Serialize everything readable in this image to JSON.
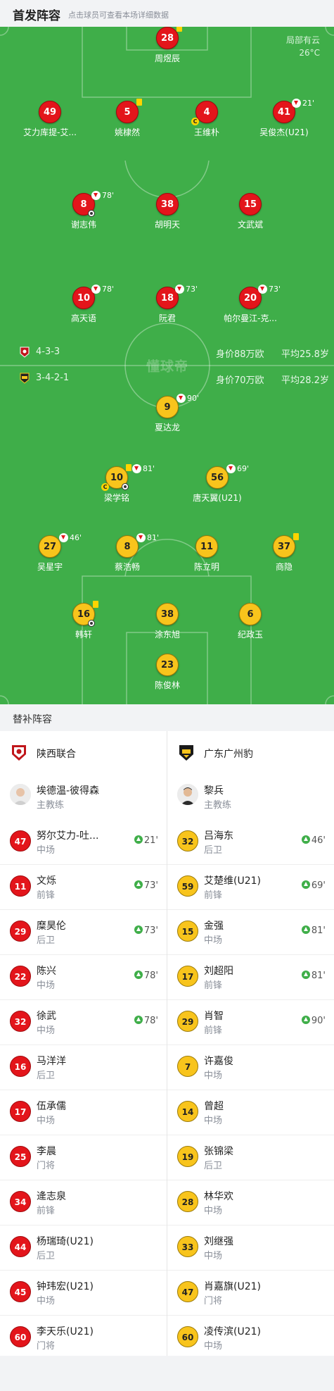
{
  "header": {
    "title": "首发阵容",
    "subtitle": "点击球员可查看本场详细数据"
  },
  "weather": {
    "condition": "局部有云",
    "temperature": "26°C"
  },
  "watermark": "懂球帝",
  "teams": {
    "home": {
      "name": "陕西联合",
      "formation": "4-3-3",
      "value": "身价88万欧",
      "avg_age": "平均25.8岁",
      "color": "#e3151b"
    },
    "away": {
      "name": "广东广州豹",
      "formation": "3-4-2-1",
      "value": "身价70万欧",
      "avg_age": "平均28.2岁",
      "color": "#f8c41c"
    }
  },
  "home_starters": [
    {
      "num": "28",
      "name": "周煜辰",
      "yellow": true
    },
    {
      "num": "49",
      "name": "艾力库提-艾..."
    },
    {
      "num": "5",
      "name": "姚棣然",
      "yellow": true
    },
    {
      "num": "4",
      "name": "王维朴",
      "captain": true
    },
    {
      "num": "41",
      "name": "吴俊杰(U21)",
      "sub_off": "21'"
    },
    {
      "num": "8",
      "name": "谢志伟",
      "sub_off": "78'",
      "goal": true
    },
    {
      "num": "38",
      "name": "胡明天"
    },
    {
      "num": "15",
      "name": "文武斌"
    },
    {
      "num": "10",
      "name": "高天语",
      "sub_off": "78'"
    },
    {
      "num": "18",
      "name": "阮君",
      "sub_off": "73'"
    },
    {
      "num": "20",
      "name": "帕尔曼江-克...",
      "sub_off": "73'"
    }
  ],
  "away_starters": [
    {
      "num": "9",
      "name": "夏达龙",
      "sub_off": "90'"
    },
    {
      "num": "10",
      "name": "梁学铭",
      "yellow": true,
      "sub_off": "81'",
      "captain": true,
      "assist": true
    },
    {
      "num": "56",
      "name": "唐天翼(U21)",
      "sub_off": "69'"
    },
    {
      "num": "27",
      "name": "吴星宇",
      "sub_off": "46'"
    },
    {
      "num": "8",
      "name": "蔡浩畅",
      "sub_off": "81'"
    },
    {
      "num": "11",
      "name": "陈立明"
    },
    {
      "num": "37",
      "name": "商隐",
      "yellow": true
    },
    {
      "num": "16",
      "name": "韩轩",
      "yellow": true,
      "goal": true
    },
    {
      "num": "38",
      "name": "涂东旭"
    },
    {
      "num": "6",
      "name": "纪政玉"
    },
    {
      "num": "23",
      "name": "陈俊林"
    }
  ],
  "captain_mark": "C",
  "subs_section": {
    "title": "替补阵容"
  },
  "home_bench": {
    "coach": {
      "name": "埃德温-彼得森",
      "role": "主教练"
    },
    "players": [
      {
        "num": "47",
        "name": "努尔艾力-吐...",
        "pos": "中场",
        "in": "21'"
      },
      {
        "num": "11",
        "name": "文烁",
        "pos": "前锋",
        "in": "73'"
      },
      {
        "num": "29",
        "name": "糜昊伦",
        "pos": "后卫",
        "in": "73'"
      },
      {
        "num": "22",
        "name": "陈兴",
        "pos": "中场",
        "in": "78'"
      },
      {
        "num": "32",
        "name": "徐武",
        "pos": "中场",
        "in": "78'"
      },
      {
        "num": "16",
        "name": "马洋洋",
        "pos": "后卫"
      },
      {
        "num": "17",
        "name": "伍承儒",
        "pos": "中场"
      },
      {
        "num": "25",
        "name": "李晨",
        "pos": "门将"
      },
      {
        "num": "34",
        "name": "逄志泉",
        "pos": "前锋"
      },
      {
        "num": "44",
        "name": "杨瑞琦(U21)",
        "pos": "后卫"
      },
      {
        "num": "45",
        "name": "钟玮宏(U21)",
        "pos": "中场"
      },
      {
        "num": "60",
        "name": "李天乐(U21)",
        "pos": "门将"
      }
    ]
  },
  "away_bench": {
    "coach": {
      "name": "黎兵",
      "role": "主教练"
    },
    "players": [
      {
        "num": "32",
        "name": "吕海东",
        "pos": "后卫",
        "in": "46'"
      },
      {
        "num": "59",
        "name": "艾楚维(U21)",
        "pos": "前锋",
        "in": "69'"
      },
      {
        "num": "15",
        "name": "金强",
        "pos": "中场",
        "in": "81'"
      },
      {
        "num": "17",
        "name": "刘超阳",
        "pos": "前锋",
        "in": "81'"
      },
      {
        "num": "29",
        "name": "肖智",
        "pos": "前锋",
        "in": "90'"
      },
      {
        "num": "7",
        "name": "许嘉俊",
        "pos": "中场"
      },
      {
        "num": "14",
        "name": "曾超",
        "pos": "中场"
      },
      {
        "num": "19",
        "name": "张锦梁",
        "pos": "后卫"
      },
      {
        "num": "28",
        "name": "林华欢",
        "pos": "中场"
      },
      {
        "num": "33",
        "name": "刘继强",
        "pos": "中场"
      },
      {
        "num": "47",
        "name": "肖嘉旗(U21)",
        "pos": "门将"
      },
      {
        "num": "60",
        "name": "凌传滨(U21)",
        "pos": "中场"
      }
    ]
  }
}
